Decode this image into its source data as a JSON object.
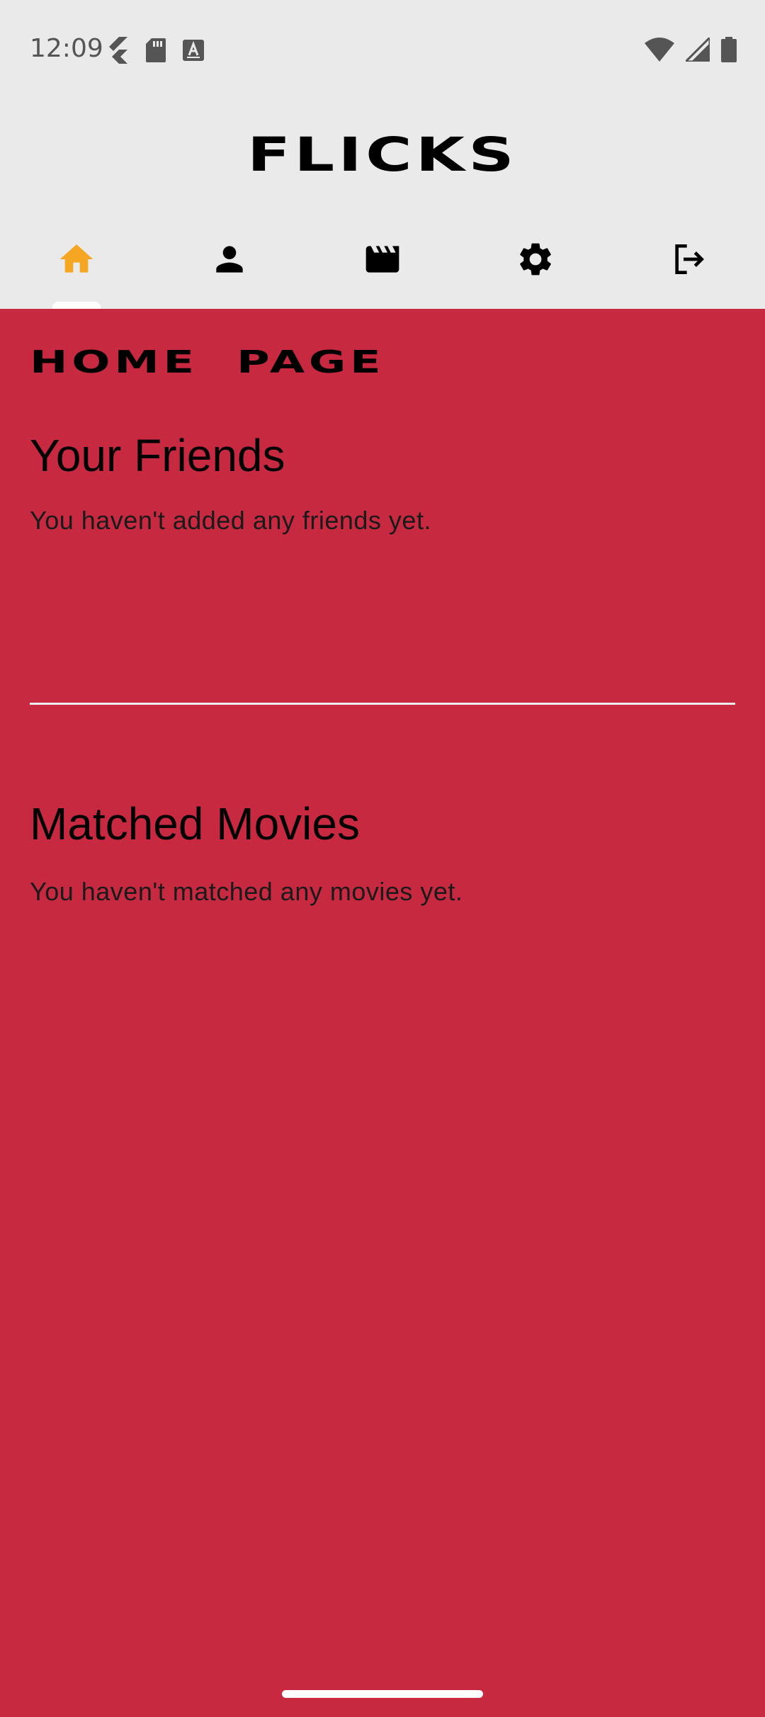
{
  "status_bar": {
    "time": "12:09",
    "left_icons": [
      "flutter-icon",
      "sd-card-icon",
      "keyboard-a-icon"
    ],
    "right_icons": [
      "wifi-icon",
      "cell-signal-icon",
      "battery-icon"
    ]
  },
  "app": {
    "title": "FLICKS"
  },
  "tabs": [
    {
      "name": "home",
      "icon": "home-icon",
      "active": true
    },
    {
      "name": "profile",
      "icon": "person-icon",
      "active": false
    },
    {
      "name": "movies",
      "icon": "clapperboard-icon",
      "active": false
    },
    {
      "name": "settings",
      "icon": "gear-icon",
      "active": false
    },
    {
      "name": "logout",
      "icon": "logout-icon",
      "active": false
    }
  ],
  "page": {
    "heading": "HOME PAGE",
    "friends": {
      "title": "Your Friends",
      "empty_text": "You haven't added any friends yet."
    },
    "movies": {
      "title": "Matched Movies",
      "empty_text": "You haven't matched any movies yet."
    }
  },
  "colors": {
    "background": "#C62940",
    "header": "#EAEAEA",
    "active_tab": "#F5A623",
    "icon": "#000000"
  }
}
